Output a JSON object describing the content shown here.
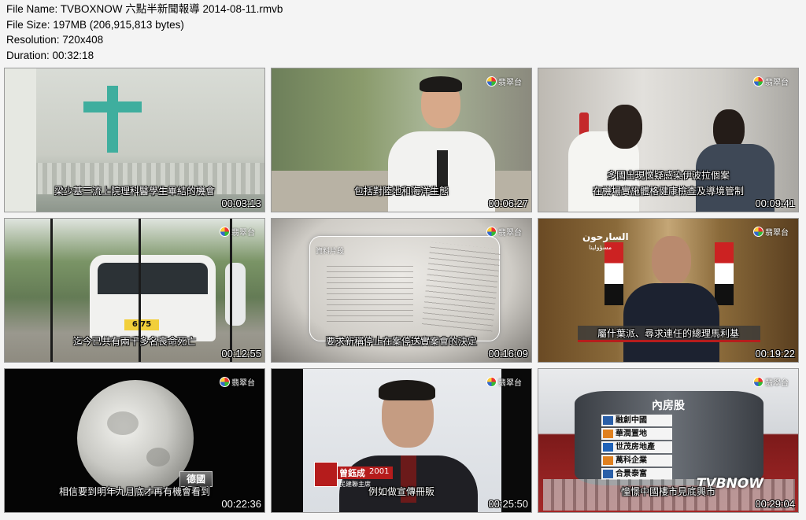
{
  "meta": {
    "file_name": "File Name: TVBOXNOW 六點半新聞報導 2014-08-11.rmvb",
    "file_size": "File Size: 197MB (206,915,813 bytes)",
    "resolution": "Resolution: 720x408",
    "duration": "Duration: 00:32:18"
  },
  "channel_logo": "翡翠台",
  "thumbnails": [
    {
      "subtitle": "梁少基三流上院理科醫學生畢結的機會",
      "timestamp": "00:03:13"
    },
    {
      "subtitle": "包括對陸地和海洋生態",
      "timestamp": "00:06:27"
    },
    {
      "subtitle": "多國出現懷疑感染伊波拉個案",
      "subtitle2": "在機場實施體格健康檢查及導境管制",
      "timestamp": "00:09:41"
    },
    {
      "subtitle": "迄今已共有兩千多名喪命死亡",
      "timestamp": "00:12:55",
      "plate": "6  75"
    },
    {
      "subtitle": "要求新稱停止在案停送實案會的決定",
      "timestamp": "00:16:09",
      "doc_label": "資料片段"
    },
    {
      "subtitle": "屬什葉派、尋求連任的總理馬利基",
      "timestamp": "00:19:22",
      "arabic_top": "السارحون",
      "arabic_sub": "مسؤولينا"
    },
    {
      "subtitle": "相信要到明年九月底才再有機會看到",
      "timestamp": "00:22:36",
      "tag": "德國"
    },
    {
      "subtitle": "例如做宣傳冊販",
      "timestamp": "00:25:50",
      "name": "曾鈺成",
      "year": "2001",
      "role": "民建聯主席"
    },
    {
      "subtitle": "憧憬中國樓市見底興市",
      "timestamp": "00:29:04",
      "board_title": "內房股",
      "stocks": [
        "融創中國",
        "華潤置地",
        "世茂房地產",
        "萬科企業",
        "合景泰富"
      ],
      "watermark": "TVBNOW"
    }
  ]
}
